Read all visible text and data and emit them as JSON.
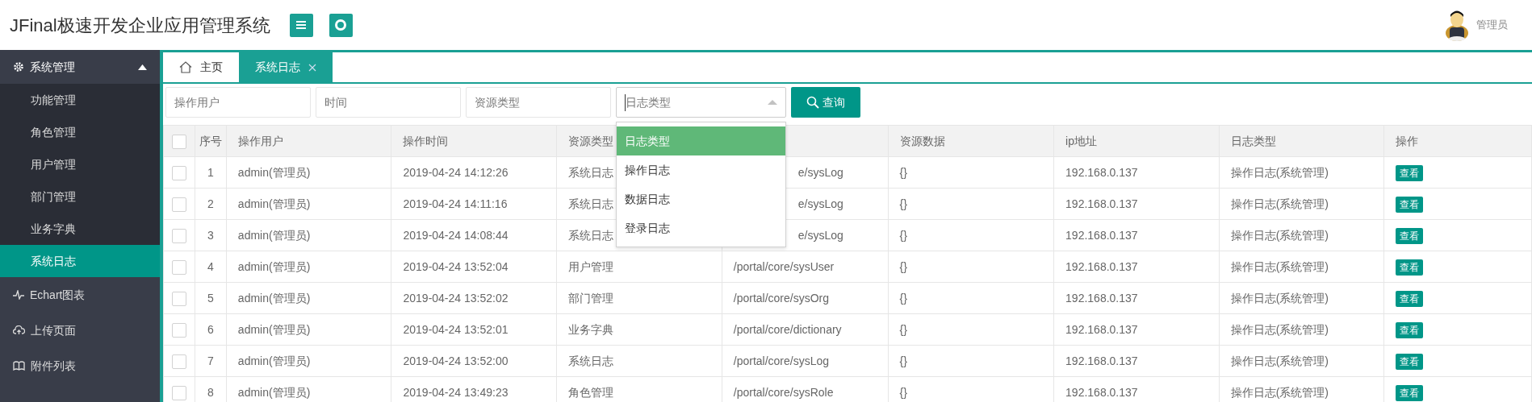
{
  "header": {
    "title": "JFinal极速开发企业应用管理系统",
    "user": "管理员"
  },
  "sidebar": {
    "items": [
      {
        "label": "系统管理",
        "expanded": true,
        "children": [
          {
            "label": "功能管理",
            "selected": false
          },
          {
            "label": "角色管理",
            "selected": false
          },
          {
            "label": "用户管理",
            "selected": false
          },
          {
            "label": "部门管理",
            "selected": false
          },
          {
            "label": "业务字典",
            "selected": false
          },
          {
            "label": "系统日志",
            "selected": true
          }
        ]
      },
      {
        "label": "Echart图表"
      },
      {
        "label": "上传页面"
      },
      {
        "label": "附件列表"
      }
    ]
  },
  "tabs": [
    {
      "label": "主页",
      "selected": false,
      "closable": false
    },
    {
      "label": "系统日志",
      "selected": true,
      "closable": true
    }
  ],
  "search": {
    "fields": [
      {
        "placeholder": "操作用户"
      },
      {
        "placeholder": "时间"
      },
      {
        "placeholder": "资源类型"
      }
    ],
    "select": {
      "placeholder": "日志类型",
      "expanded": true,
      "options": [
        {
          "label": "日志类型",
          "selected": true
        },
        {
          "label": "操作日志",
          "selected": false
        },
        {
          "label": "数据日志",
          "selected": false
        },
        {
          "label": "登录日志",
          "selected": false
        }
      ]
    },
    "button": "查询"
  },
  "table": {
    "all_checked": false,
    "columns": [
      "序号",
      "操作用户",
      "操作时间",
      "资源类型",
      null,
      "资源数据",
      "ip地址",
      "日志类型",
      "操作"
    ],
    "rows": [
      {
        "checked": false,
        "cells": [
          "1",
          "admin(管理员)",
          "2019-04-24 14:12:26",
          "系统日志",
          "e/sysLog",
          "{}",
          "192.168.0.137",
          "操作日志(系统管理)"
        ],
        "partial": true,
        "action": "查看"
      },
      {
        "checked": false,
        "cells": [
          "2",
          "admin(管理员)",
          "2019-04-24 14:11:16",
          "系统日志",
          "e/sysLog",
          "{}",
          "192.168.0.137",
          "操作日志(系统管理)"
        ],
        "partial": true,
        "action": "查看"
      },
      {
        "checked": false,
        "cells": [
          "3",
          "admin(管理员)",
          "2019-04-24 14:08:44",
          "系统日志",
          "e/sysLog",
          "{}",
          "192.168.0.137",
          "操作日志(系统管理)"
        ],
        "partial": true,
        "action": "查看"
      },
      {
        "checked": false,
        "cells": [
          "4",
          "admin(管理员)",
          "2019-04-24 13:52:04",
          "用户管理",
          "/portal/core/sysUser",
          "{}",
          "192.168.0.137",
          "操作日志(系统管理)"
        ],
        "partial": false,
        "action": "查看"
      },
      {
        "checked": false,
        "cells": [
          "5",
          "admin(管理员)",
          "2019-04-24 13:52:02",
          "部门管理",
          "/portal/core/sysOrg",
          "{}",
          "192.168.0.137",
          "操作日志(系统管理)"
        ],
        "partial": false,
        "action": "查看"
      },
      {
        "checked": false,
        "cells": [
          "6",
          "admin(管理员)",
          "2019-04-24 13:52:01",
          "业务字典",
          "/portal/core/dictionary",
          "{}",
          "192.168.0.137",
          "操作日志(系统管理)"
        ],
        "partial": false,
        "action": "查看"
      },
      {
        "checked": false,
        "cells": [
          "7",
          "admin(管理员)",
          "2019-04-24 13:52:00",
          "系统日志",
          "/portal/core/sysLog",
          "{}",
          "192.168.0.137",
          "操作日志(系统管理)"
        ],
        "partial": false,
        "action": "查看"
      },
      {
        "checked": false,
        "cells": [
          "8",
          "admin(管理员)",
          "2019-04-24 13:49:23",
          "角色管理",
          "/portal/core/sysRole",
          "{}",
          "192.168.0.137",
          "操作日志(系统管理)"
        ],
        "partial": false,
        "action": "查看"
      }
    ]
  }
}
